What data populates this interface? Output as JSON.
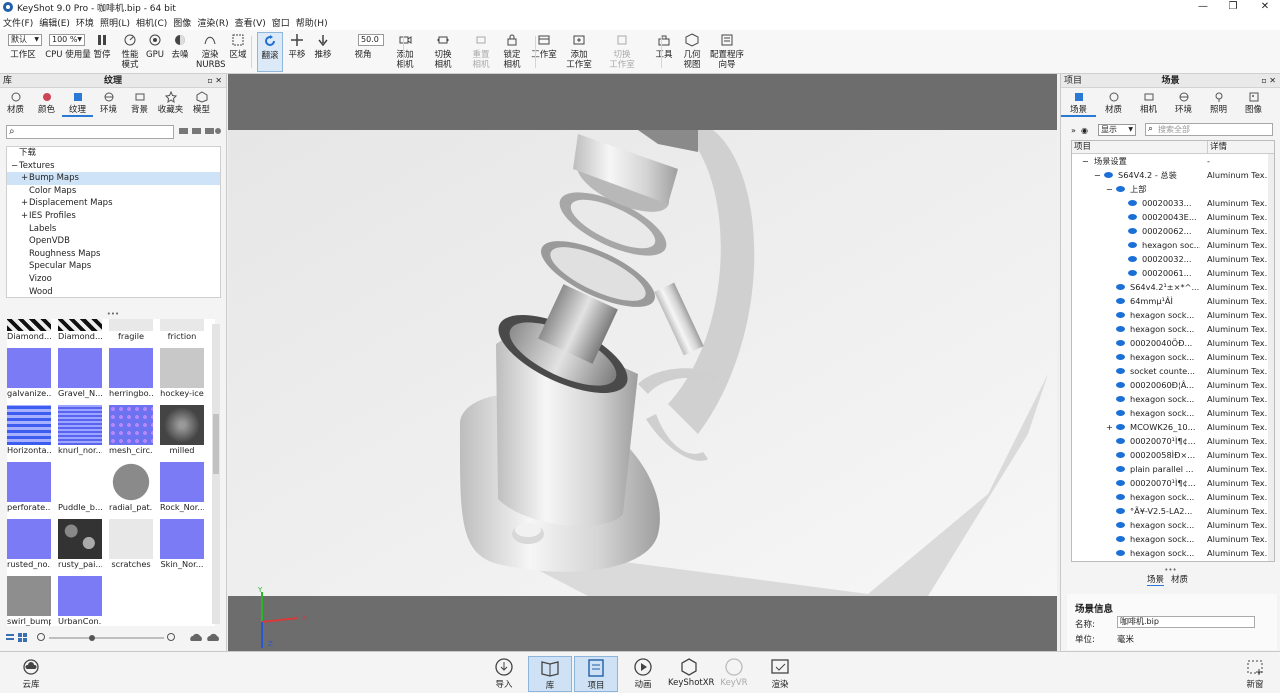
{
  "window": {
    "title": "KeyShot 9.0 Pro  - 咖啡机.bip  - 64 bit",
    "min": "—",
    "max": "❐",
    "close": "✕"
  },
  "menu": [
    "文件(F)",
    "编辑(E)",
    "环境",
    "照明(L)",
    "相机(C)",
    "图像",
    "渲染(R)",
    "查看(V)",
    "窗口",
    "帮助(H)"
  ],
  "toolbar": {
    "workspace_combo": "默认",
    "zoom_combo": "100 %",
    "fov_value": "50.0",
    "items": [
      {
        "key": "workspace",
        "label": "工作区",
        "icon": "workspace-icon"
      },
      {
        "key": "cpu",
        "label": "CPU 使用量",
        "icon": "cpu-icon"
      },
      {
        "key": "pause",
        "label": "暂停",
        "icon": "pause-icon"
      },
      {
        "key": "perf",
        "label": "性能\n模式",
        "icon": "performance-icon"
      },
      {
        "key": "gpu",
        "label": "GPU",
        "icon": "gpu-icon"
      },
      {
        "key": "denoise",
        "label": "去噪",
        "icon": "denoise-icon"
      },
      {
        "key": "nurbs",
        "label": "渲染\nNURBS",
        "icon": "nurbs-icon"
      },
      {
        "key": "region",
        "label": "区域",
        "icon": "region-icon"
      },
      {
        "key": "tumble",
        "label": "翻滚",
        "icon": "tumble-icon"
      },
      {
        "key": "pan",
        "label": "平移",
        "icon": "pan-icon"
      },
      {
        "key": "dolly",
        "label": "推移",
        "icon": "dolly-icon"
      },
      {
        "key": "fov",
        "label": "视角",
        "icon": "fov-icon"
      },
      {
        "key": "addcam",
        "label": "添加\n相机",
        "icon": "add-camera-icon"
      },
      {
        "key": "switchcam",
        "label": "切换\n相机",
        "icon": "switch-camera-icon"
      },
      {
        "key": "resetcam",
        "label": "重置\n相机",
        "icon": "reset-camera-icon"
      },
      {
        "key": "lockcam",
        "label": "锁定\n相机",
        "icon": "lock-camera-icon"
      },
      {
        "key": "studio",
        "label": "工作室",
        "icon": "studio-icon"
      },
      {
        "key": "addstudio",
        "label": "添加\n工作室",
        "icon": "add-studio-icon"
      },
      {
        "key": "switchstudio",
        "label": "切换\n工作室",
        "icon": "switch-studio-icon"
      },
      {
        "key": "tools",
        "label": "工具",
        "icon": "tools-icon"
      },
      {
        "key": "geoview",
        "label": "几何\n视图",
        "icon": "geometry-view-icon"
      },
      {
        "key": "wizard",
        "label": "配置程序\n向导",
        "icon": "configurator-wizard-icon"
      }
    ]
  },
  "library": {
    "panel_label": "库",
    "title": "纹理",
    "head_buttons": "▫ ✕",
    "tabs": [
      {
        "label": "材质",
        "icon": "material-icon"
      },
      {
        "label": "颜色",
        "icon": "color-icon"
      },
      {
        "label": "纹理",
        "icon": "texture-icon"
      },
      {
        "label": "环境",
        "icon": "environment-icon"
      },
      {
        "label": "背景",
        "icon": "background-icon"
      },
      {
        "label": "收藏夹",
        "icon": "favorites-icon"
      },
      {
        "label": "模型",
        "icon": "model-icon"
      }
    ],
    "search_icon": "⌕",
    "tree": [
      {
        "label": "下载",
        "indent": 0,
        "expander": ""
      },
      {
        "label": "Textures",
        "indent": 0,
        "expander": "−"
      },
      {
        "label": "Bump Maps",
        "indent": 1,
        "expander": "+",
        "selected": true
      },
      {
        "label": "Color Maps",
        "indent": 1,
        "expander": ""
      },
      {
        "label": "Displacement Maps",
        "indent": 1,
        "expander": "+"
      },
      {
        "label": "IES Profiles",
        "indent": 1,
        "expander": "+"
      },
      {
        "label": "Labels",
        "indent": 1,
        "expander": ""
      },
      {
        "label": "OpenVDB",
        "indent": 1,
        "expander": ""
      },
      {
        "label": "Roughness Maps",
        "indent": 1,
        "expander": ""
      },
      {
        "label": "Specular Maps",
        "indent": 1,
        "expander": ""
      },
      {
        "label": "Vizoo",
        "indent": 1,
        "expander": ""
      },
      {
        "label": "Wood",
        "indent": 1,
        "expander": ""
      }
    ],
    "splitter": "•••",
    "thumbs": [
      {
        "label": "Diamond...",
        "style": "diamond"
      },
      {
        "label": "Diamond...",
        "style": "diamond"
      },
      {
        "label": "fragile",
        "style": "lightgray"
      },
      {
        "label": "friction",
        "style": "lightgray"
      },
      {
        "label": "galvanize...",
        "style": "blue"
      },
      {
        "label": "Gravel_N...",
        "style": "blue"
      },
      {
        "label": "herringbo...",
        "style": "blue"
      },
      {
        "label": "hockey-ice",
        "style": "gray"
      },
      {
        "label": "Horizonta...",
        "style": "stripes"
      },
      {
        "label": "knurl_nor...",
        "style": "grid"
      },
      {
        "label": "mesh_circ...",
        "style": "dots"
      },
      {
        "label": "milled",
        "style": "dark"
      },
      {
        "label": "perforate...",
        "style": "blue"
      },
      {
        "label": "Puddle_b...",
        "style": "white"
      },
      {
        "label": "radial_pat...",
        "style": "circle"
      },
      {
        "label": "Rock_Nor...",
        "style": "blue"
      },
      {
        "label": "rusted_no...",
        "style": "blue"
      },
      {
        "label": "rusty_pai...",
        "style": "camo"
      },
      {
        "label": "scratches",
        "style": "lightgray"
      },
      {
        "label": "Skin_Nor...",
        "style": "blue"
      },
      {
        "label": "swirl_bump",
        "style": "midgray"
      },
      {
        "label": "UrbanCon...",
        "style": "blue"
      }
    ]
  },
  "project": {
    "panel_label": "项目",
    "title": "场景",
    "head_buttons": "▫ ✕",
    "tabs": [
      {
        "label": "场景",
        "icon": "scene-icon"
      },
      {
        "label": "材质",
        "icon": "material-icon"
      },
      {
        "label": "相机",
        "icon": "camera-icon"
      },
      {
        "label": "环境",
        "icon": "environment-icon"
      },
      {
        "label": "照明",
        "icon": "lighting-icon"
      },
      {
        "label": "图像",
        "icon": "image-icon"
      }
    ],
    "display_combo": "显示",
    "search_placeholder": "搜索全部",
    "col_item": "项目",
    "col_detail": "详情",
    "rows": [
      {
        "name": "场景设置",
        "detail": "-",
        "indent": 1,
        "eye": false,
        "exp": "−"
      },
      {
        "name": "S64V4.2 - 总装",
        "detail": "Aluminum Tex...",
        "indent": 2,
        "eye": true,
        "exp": "−"
      },
      {
        "name": "上部",
        "detail": "",
        "indent": 3,
        "eye": true,
        "exp": "−"
      },
      {
        "name": "00020033...",
        "detail": "Aluminum Tex...",
        "indent": 4,
        "eye": true,
        "exp": ""
      },
      {
        "name": "00020043E...",
        "detail": "Aluminum Tex...",
        "indent": 4,
        "eye": true,
        "exp": ""
      },
      {
        "name": "00020062...",
        "detail": "Aluminum Tex...",
        "indent": 4,
        "eye": true,
        "exp": ""
      },
      {
        "name": "hexagon soc...",
        "detail": "Aluminum Tex...",
        "indent": 4,
        "eye": true,
        "exp": ""
      },
      {
        "name": "00020032...",
        "detail": "Aluminum Tex...",
        "indent": 4,
        "eye": true,
        "exp": ""
      },
      {
        "name": "00020061...",
        "detail": "Aluminum Tex...",
        "indent": 4,
        "eye": true,
        "exp": ""
      },
      {
        "name": "S64v4.2¹±×*^...",
        "detail": "Aluminum Tex...",
        "indent": 3,
        "eye": true,
        "exp": ""
      },
      {
        "name": "64mmµ¹ÂÌ",
        "detail": "Aluminum Tex...",
        "indent": 3,
        "eye": true,
        "exp": ""
      },
      {
        "name": "hexagon sock...",
        "detail": "Aluminum Tex...",
        "indent": 3,
        "eye": true,
        "exp": ""
      },
      {
        "name": "hexagon sock...",
        "detail": "Aluminum Tex...",
        "indent": 3,
        "eye": true,
        "exp": ""
      },
      {
        "name": "00020040ÖÐ...",
        "detail": "Aluminum Tex...",
        "indent": 3,
        "eye": true,
        "exp": ""
      },
      {
        "name": "hexagon sock...",
        "detail": "Aluminum Tex...",
        "indent": 3,
        "eye": true,
        "exp": ""
      },
      {
        "name": "socket counte...",
        "detail": "Aluminum Tex...",
        "indent": 3,
        "eye": true,
        "exp": ""
      },
      {
        "name": "00020060Ð¦Â...",
        "detail": "Aluminum Tex...",
        "indent": 3,
        "eye": true,
        "exp": ""
      },
      {
        "name": "hexagon sock...",
        "detail": "Aluminum Tex...",
        "indent": 3,
        "eye": true,
        "exp": ""
      },
      {
        "name": "hexagon sock...",
        "detail": "Aluminum Tex...",
        "indent": 3,
        "eye": true,
        "exp": ""
      },
      {
        "name": "MCOWK26_10...",
        "detail": "Aluminum Tex...",
        "indent": 3,
        "eye": true,
        "exp": "+"
      },
      {
        "name": "00020070¹Ì¶¢...",
        "detail": "Aluminum Tex...",
        "indent": 3,
        "eye": true,
        "exp": ""
      },
      {
        "name": "00020058ÌÐ×...",
        "detail": "Aluminum Tex...",
        "indent": 3,
        "eye": true,
        "exp": ""
      },
      {
        "name": "plain parallel ...",
        "detail": "Aluminum Tex...",
        "indent": 3,
        "eye": true,
        "exp": ""
      },
      {
        "name": "00020070¹Ì¶¢...",
        "detail": "Aluminum Tex...",
        "indent": 3,
        "eye": true,
        "exp": ""
      },
      {
        "name": "hexagon sock...",
        "detail": "Aluminum Tex...",
        "indent": 3,
        "eye": true,
        "exp": ""
      },
      {
        "name": "°Ã¥-V2.5-LA2...",
        "detail": "Aluminum Tex...",
        "indent": 3,
        "eye": true,
        "exp": ""
      },
      {
        "name": "hexagon sock...",
        "detail": "Aluminum Tex...",
        "indent": 3,
        "eye": true,
        "exp": ""
      },
      {
        "name": "hexagon sock...",
        "detail": "Aluminum Tex...",
        "indent": 3,
        "eye": true,
        "exp": ""
      },
      {
        "name": "hexagon sock...",
        "detail": "Aluminum Tex...",
        "indent": 3,
        "eye": true,
        "exp": ""
      }
    ],
    "splitter": "•••",
    "subtabs": [
      "场景",
      "材质"
    ],
    "info_title": "场景信息",
    "info_name_label": "名称:",
    "info_name_value": "咖啡机.bip",
    "info_unit_label": "单位:",
    "info_unit_value": "毫米"
  },
  "viewport": {
    "axis_y": "Y",
    "axis_x": "X",
    "axis_z": "Z"
  },
  "bottom": {
    "cloud": "云库",
    "newwin": "新窗",
    "items": [
      {
        "label": "导入",
        "icon": "import-icon"
      },
      {
        "label": "库",
        "icon": "library-icon",
        "active": true
      },
      {
        "label": "项目",
        "icon": "project-icon",
        "active": true
      },
      {
        "label": "动画",
        "icon": "animation-icon"
      },
      {
        "label": "KeyShotXR",
        "icon": "keyshotxr-icon"
      },
      {
        "label": "KeyVR",
        "icon": "keyvr-icon",
        "dim": true
      },
      {
        "label": "渲染",
        "icon": "render-icon"
      }
    ]
  }
}
